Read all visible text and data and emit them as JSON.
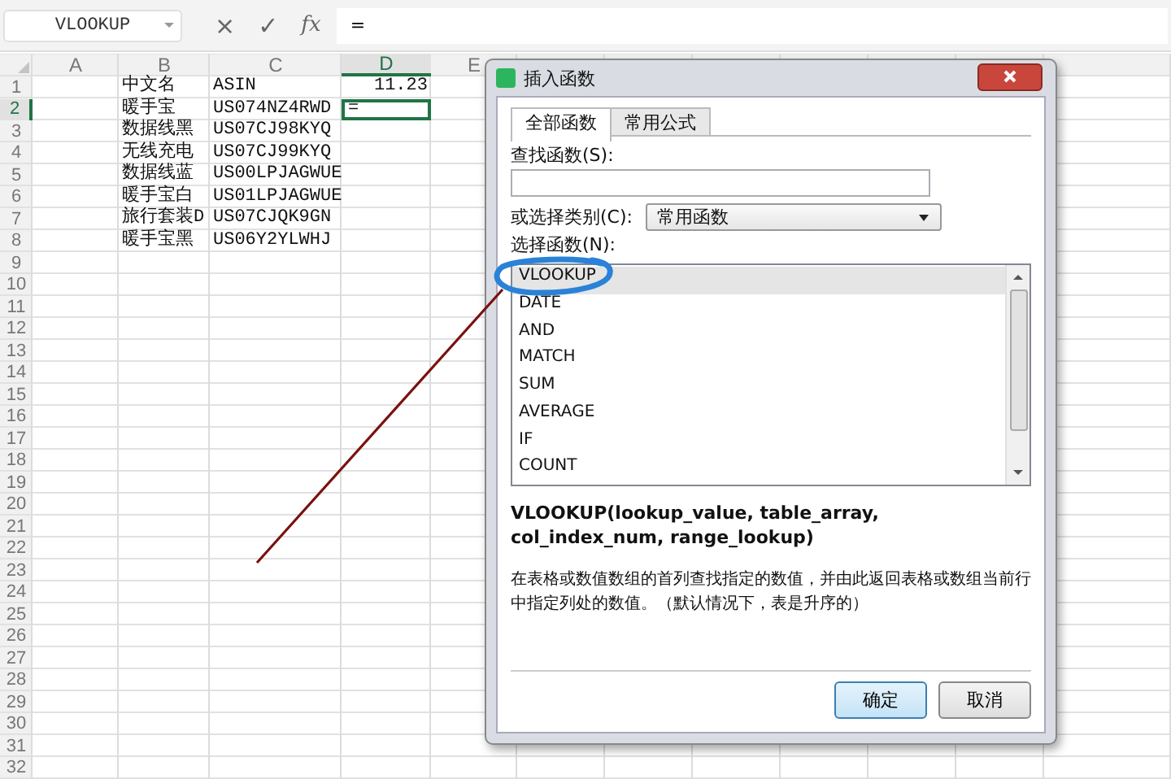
{
  "formula_bar": {
    "name_box": "VLOOKUP",
    "buttons": [
      "×",
      "✓",
      "fx"
    ],
    "value": "="
  },
  "sheet": {
    "columns": [
      {
        "label": "A",
        "selected": false
      },
      {
        "label": "B",
        "selected": false
      },
      {
        "label": "C",
        "selected": false
      },
      {
        "label": "D",
        "selected": true
      },
      {
        "label": "E",
        "selected": false
      }
    ],
    "rows": [
      {
        "number": "1",
        "selected": false,
        "cells": [
          "",
          "中文名",
          "ASIN",
          {
            "text": "11.23",
            "kind": "number"
          }
        ]
      },
      {
        "number": "2",
        "selected": true,
        "cells": [
          "",
          "暖手宝",
          "US074NZ4RWD",
          "="
        ]
      },
      {
        "number": "3",
        "selected": false,
        "cells": [
          "",
          "数据线黑",
          "US07CJ98KYQ"
        ]
      },
      {
        "number": "4",
        "selected": false,
        "cells": [
          "",
          "无线充电",
          "US07CJ99KYQ"
        ]
      },
      {
        "number": "5",
        "selected": false,
        "cells": [
          "",
          "数据线蓝",
          "US00LPJAGWUE"
        ]
      },
      {
        "number": "6",
        "selected": false,
        "cells": [
          "",
          "暖手宝白",
          "US01LPJAGWUE"
        ]
      },
      {
        "number": "7",
        "selected": false,
        "cells": [
          "",
          "旅行套装D",
          "US07CJQK9GN"
        ]
      },
      {
        "number": "8",
        "selected": false,
        "cells": [
          "",
          "暖手宝黑",
          "US06Y2YLWHJ"
        ]
      },
      {
        "number": "9",
        "selected": false,
        "cells": []
      },
      {
        "number": "10",
        "selected": false,
        "cells": []
      },
      {
        "number": "11",
        "selected": false,
        "cells": []
      },
      {
        "number": "12",
        "selected": false,
        "cells": []
      },
      {
        "number": "13",
        "selected": false,
        "cells": []
      },
      {
        "number": "14",
        "selected": false,
        "cells": []
      },
      {
        "number": "15",
        "selected": false,
        "cells": []
      },
      {
        "number": "16",
        "selected": false,
        "cells": []
      },
      {
        "number": "17",
        "selected": false,
        "cells": []
      },
      {
        "number": "18",
        "selected": false,
        "cells": []
      },
      {
        "number": "19",
        "selected": false,
        "cells": []
      },
      {
        "number": "20",
        "selected": false,
        "cells": []
      },
      {
        "number": "21",
        "selected": false,
        "cells": []
      },
      {
        "number": "22",
        "selected": false,
        "cells": []
      },
      {
        "number": "23",
        "selected": false,
        "cells": []
      },
      {
        "number": "24",
        "selected": false,
        "cells": []
      },
      {
        "number": "25",
        "selected": false,
        "cells": []
      },
      {
        "number": "26",
        "selected": false,
        "cells": []
      },
      {
        "number": "27",
        "selected": false,
        "cells": []
      },
      {
        "number": "28",
        "selected": false,
        "cells": []
      },
      {
        "number": "29",
        "selected": false,
        "cells": []
      },
      {
        "number": "30",
        "selected": false,
        "cells": []
      },
      {
        "number": "31",
        "selected": false,
        "cells": []
      },
      {
        "number": "32",
        "selected": false,
        "cells": []
      }
    ]
  },
  "dialog": {
    "title": "插入函数",
    "tabs": [
      {
        "label": "全部函数",
        "selected": true
      },
      {
        "label": "常用公式",
        "selected": false
      }
    ],
    "search_label": "查找函数(S):",
    "category_label": "或选择类别(C):",
    "category": "常用函数",
    "function_label": "选择函数(N):",
    "functions": [
      {
        "name": "VLOOKUP",
        "selected": true
      },
      {
        "name": "DATE",
        "selected": false
      },
      {
        "name": "AND",
        "selected": false
      },
      {
        "name": "MATCH",
        "selected": false
      },
      {
        "name": "SUM",
        "selected": false
      },
      {
        "name": "AVERAGE",
        "selected": false
      },
      {
        "name": "IF",
        "selected": false
      },
      {
        "name": "COUNT",
        "selected": false
      }
    ],
    "signature": "VLOOKUP(lookup_value, table_array, col_index_num, range_lookup)",
    "description": "在表格或数值数组的首列查找指定的数值，并由此返回表格或数组当前行中指定列处的数值。（默认情况下，表是升序的）",
    "buttons": [
      {
        "label": "确定",
        "kind": "default"
      },
      {
        "label": "取消",
        "kind": "normal"
      }
    ]
  }
}
